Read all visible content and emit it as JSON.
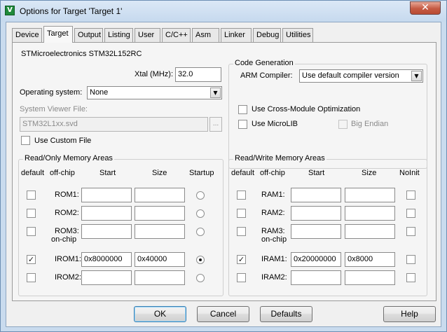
{
  "window": {
    "title": "Options for Target 'Target 1'",
    "close_glyph": "✕"
  },
  "tabs": [
    {
      "label": "Device",
      "active": false
    },
    {
      "label": "Target",
      "active": true
    },
    {
      "label": "Output",
      "active": false
    },
    {
      "label": "Listing",
      "active": false
    },
    {
      "label": "User",
      "active": false
    },
    {
      "label": "C/C++",
      "active": false
    },
    {
      "label": "Asm",
      "active": false
    },
    {
      "label": "Linker",
      "active": false
    },
    {
      "label": "Debug",
      "active": false
    },
    {
      "label": "Utilities",
      "active": false
    }
  ],
  "target": {
    "device_name": "STMicroelectronics STM32L152RC",
    "xtal_label": "Xtal (MHz):",
    "xtal_value": "32.0",
    "os_label": "Operating system:",
    "os_value": "None",
    "svf_label": "System Viewer File:",
    "svf_value": "STM32L1xx.svd",
    "browse_label": "...",
    "custom_file_label": "Use Custom File",
    "custom_file_checked": false
  },
  "codegen": {
    "title": "Code Generation",
    "compiler_label": "ARM Compiler:",
    "compiler_value": "Use default compiler version",
    "cross_module_label": "Use Cross-Module Optimization",
    "cross_module_checked": false,
    "microlib_label": "Use MicroLIB",
    "microlib_checked": false,
    "big_endian_label": "Big Endian",
    "big_endian_checked": false
  },
  "rom": {
    "title": "Read/Only Memory Areas",
    "headers": {
      "default": "default",
      "offchip": "off-chip",
      "start": "Start",
      "size": "Size",
      "startup": "Startup"
    },
    "onchip_label": "on-chip",
    "rows": [
      {
        "name": "ROM1:",
        "default": false,
        "start": "",
        "size": "",
        "startup": false
      },
      {
        "name": "ROM2:",
        "default": false,
        "start": "",
        "size": "",
        "startup": false
      },
      {
        "name": "ROM3:",
        "default": false,
        "start": "",
        "size": "",
        "startup": false
      },
      {
        "name": "IROM1:",
        "default": true,
        "start": "0x8000000",
        "size": "0x40000",
        "startup": true
      },
      {
        "name": "IROM2:",
        "default": false,
        "start": "",
        "size": "",
        "startup": false
      }
    ]
  },
  "ram": {
    "title": "Read/Write Memory Areas",
    "headers": {
      "default": "default",
      "offchip": "off-chip",
      "start": "Start",
      "size": "Size",
      "noinit": "NoInit"
    },
    "onchip_label": "on-chip",
    "rows": [
      {
        "name": "RAM1:",
        "default": false,
        "start": "",
        "size": "",
        "noinit": false
      },
      {
        "name": "RAM2:",
        "default": false,
        "start": "",
        "size": "",
        "noinit": false
      },
      {
        "name": "RAM3:",
        "default": false,
        "start": "",
        "size": "",
        "noinit": false
      },
      {
        "name": "IRAM1:",
        "default": true,
        "start": "0x20000000",
        "size": "0x8000",
        "noinit": false
      },
      {
        "name": "IRAM2:",
        "default": false,
        "start": "",
        "size": "",
        "noinit": false
      }
    ]
  },
  "buttons": {
    "ok": "OK",
    "cancel": "Cancel",
    "defaults": "Defaults",
    "help": "Help"
  },
  "check_glyph": "✓",
  "dropdown_glyph": "▼"
}
